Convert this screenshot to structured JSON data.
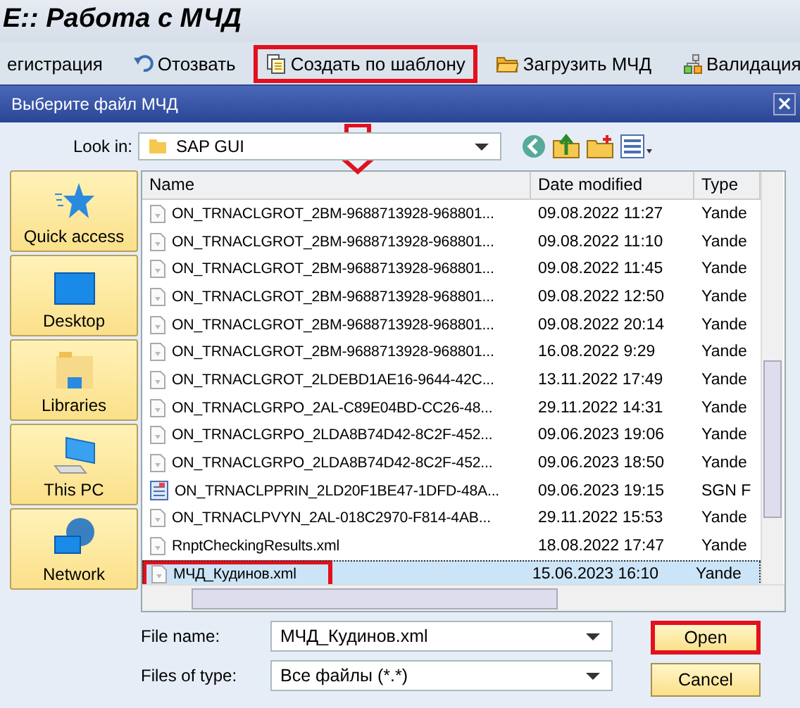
{
  "window": {
    "title": "E:: Работа с МЧД"
  },
  "toolbar": [
    {
      "label": "егистрация",
      "highlighted": false
    },
    {
      "label": "Отозвать",
      "highlighted": false
    },
    {
      "label": "Создать по шаблону",
      "highlighted": true
    },
    {
      "label": "Загрузить МЧД",
      "highlighted": false
    },
    {
      "label": "Валидация",
      "highlighted": false
    }
  ],
  "dialog": {
    "title": "Выберите файл МЧД",
    "close": "×",
    "look_in": {
      "label": "Look in:",
      "value": "SAP GUI"
    },
    "places": [
      {
        "label": "Quick access"
      },
      {
        "label": "Desktop"
      },
      {
        "label": "Libraries"
      },
      {
        "label": "This PC"
      },
      {
        "label": "Network"
      }
    ],
    "columns": [
      "Name",
      "Date modified",
      "Type"
    ],
    "rows": [
      {
        "name": "ON_TRNACLGROT_2BM-9688713928-968801...",
        "date": "09.08.2022 11:27",
        "type": "Yande",
        "kind": "xml",
        "selected": false,
        "highlighted": false
      },
      {
        "name": "ON_TRNACLGROT_2BM-9688713928-968801...",
        "date": "09.08.2022 11:10",
        "type": "Yande",
        "kind": "xml",
        "selected": false,
        "highlighted": false
      },
      {
        "name": "ON_TRNACLGROT_2BM-9688713928-968801...",
        "date": "09.08.2022 11:45",
        "type": "Yande",
        "kind": "xml",
        "selected": false,
        "highlighted": false
      },
      {
        "name": "ON_TRNACLGROT_2BM-9688713928-968801...",
        "date": "09.08.2022 12:50",
        "type": "Yande",
        "kind": "xml",
        "selected": false,
        "highlighted": false
      },
      {
        "name": "ON_TRNACLGROT_2BM-9688713928-968801...",
        "date": "09.08.2022 20:14",
        "type": "Yande",
        "kind": "xml",
        "selected": false,
        "highlighted": false
      },
      {
        "name": "ON_TRNACLGROT_2BM-9688713928-968801...",
        "date": "16.08.2022 9:29",
        "type": "Yande",
        "kind": "xml",
        "selected": false,
        "highlighted": false
      },
      {
        "name": "ON_TRNACLGROT_2LDEBD1AE16-9644-42C...",
        "date": "13.11.2022 17:49",
        "type": "Yande",
        "kind": "xml",
        "selected": false,
        "highlighted": false
      },
      {
        "name": "ON_TRNACLGRPO_2AL-C89E04BD-CC26-48...",
        "date": "29.11.2022 14:31",
        "type": "Yande",
        "kind": "xml",
        "selected": false,
        "highlighted": false
      },
      {
        "name": "ON_TRNACLGRPO_2LDA8B74D42-8C2F-452...",
        "date": "09.06.2023 19:06",
        "type": "Yande",
        "kind": "xml",
        "selected": false,
        "highlighted": false
      },
      {
        "name": "ON_TRNACLGRPO_2LDA8B74D42-8C2F-452...",
        "date": "09.06.2023 18:50",
        "type": "Yande",
        "kind": "xml",
        "selected": false,
        "highlighted": false
      },
      {
        "name": "ON_TRNACLPPRIN_2LD20F1BE47-1DFD-48A...",
        "date": "09.06.2023 19:15",
        "type": "SGN F",
        "kind": "sgn",
        "selected": false,
        "highlighted": false
      },
      {
        "name": "ON_TRNACLPVYN_2AL-018C2970-F814-4AB...",
        "date": "29.11.2022 15:53",
        "type": "Yande",
        "kind": "xml",
        "selected": false,
        "highlighted": false
      },
      {
        "name": "RnptCheckingResults.xml",
        "date": "18.08.2022 17:47",
        "type": "Yande",
        "kind": "xml",
        "selected": false,
        "highlighted": false
      },
      {
        "name": "МЧД_Кудинов.xml",
        "date": "15.06.2023 16:10",
        "type": "Yande",
        "kind": "xml",
        "selected": true,
        "highlighted": true
      }
    ],
    "file_name": {
      "label": "File name:",
      "value": "МЧД_Кудинов.xml"
    },
    "file_type": {
      "label": "Files of type:",
      "value": "Все файлы (*.*)"
    },
    "buttons": [
      {
        "label": "Open",
        "highlighted": true
      },
      {
        "label": "Cancel",
        "highlighted": false
      }
    ]
  }
}
